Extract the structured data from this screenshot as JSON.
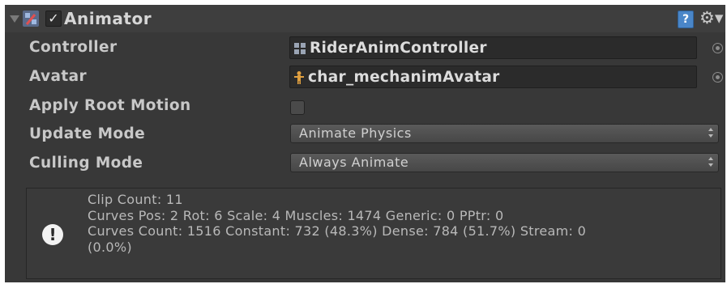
{
  "component": {
    "title": "Animator",
    "enabled": true,
    "icons": {
      "fold": "foldout-arrow-icon",
      "component": "animator-component-icon",
      "help": "help-book-icon",
      "settings": "gear-icon"
    }
  },
  "fields": {
    "controller": {
      "label": "Controller",
      "value": "RiderAnimController",
      "icon": "animator-controller-icon"
    },
    "avatar": {
      "label": "Avatar",
      "value": "char_mechanimAvatar",
      "icon": "avatar-icon"
    },
    "apply_root_motion": {
      "label": "Apply Root Motion",
      "checked": false
    },
    "update_mode": {
      "label": "Update Mode",
      "value": "Animate Physics"
    },
    "culling_mode": {
      "label": "Culling Mode",
      "value": "Always Animate"
    }
  },
  "info": {
    "icon": "info-icon",
    "lines": [
      "Clip Count: 11",
      "Curves Pos: 2 Rot: 6 Scale: 4 Muscles: 1474 Generic: 0 PPtr: 0",
      "Curves Count: 1516 Constant: 732 (48.3%) Dense: 784 (51.7%) Stream: 0",
      "(0.0%)"
    ]
  },
  "colors": {
    "background": "#383838",
    "header": "#3e3e3e",
    "field": "#2b2b2b",
    "text": "#c8c8c8"
  }
}
